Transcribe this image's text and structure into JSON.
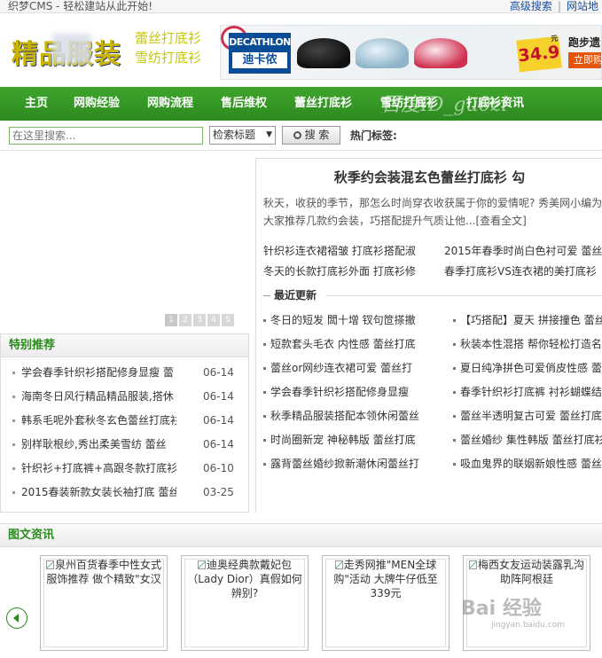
{
  "topbar": {
    "slogan": "织梦CMS - 轻松建站从此开始!",
    "links": [
      "高级搜索",
      "网站地"
    ]
  },
  "header": {
    "logo_text": "精品服装",
    "sub_lines": [
      "蕾丝打底衫",
      "雪纺打底衫"
    ],
    "banner": {
      "brand_en": "DECATHLON",
      "brand_cn": "迪卡侬",
      "price": "34.9",
      "price_unit": "元",
      "tag1": "跑步遗",
      "tag2": "立即购"
    }
  },
  "nav": {
    "items": [
      "主页",
      "网购经验",
      "网购流程",
      "售后维权",
      "蕾丝打底衫",
      "雪纺打底衫",
      "打底衫资讯"
    ],
    "watermark": "百度ID_gu0zi"
  },
  "search": {
    "placeholder": "在这里搜索...",
    "select_value": "检索标题",
    "button_label": "搜 索",
    "hot_label": "热门标签:"
  },
  "slideshow": {
    "pages": [
      "1",
      "2",
      "3",
      "4",
      "5"
    ]
  },
  "special": {
    "title": "特别推荐",
    "items": [
      {
        "title": "学会春季针织衫搭配修身显瘦 蕾",
        "date": "06-14"
      },
      {
        "title": "海南冬日风行精品精品服装,搭休",
        "date": "06-14"
      },
      {
        "title": "韩系毛呢外套秋冬玄色蕾丝打底衫",
        "date": "06-14"
      },
      {
        "title": "别样耿根纱,秀出柔美雪纺 蕾丝",
        "date": "06-14"
      },
      {
        "title": "针织衫+打底裤+高跟冬款打底衫搭",
        "date": "06-10"
      },
      {
        "title": "2015春装新款女装长袖打底 蕾丝",
        "date": "03-25"
      }
    ]
  },
  "headline": {
    "title": "秋季约会装混玄色蕾丝打底衫 勾",
    "summary": "秋天，收获的季节，那怎么时尚穿衣收获属于你的爱情呢? 秀美网小编为大家推荐几款约会装，巧搭配提升气质让他...",
    "more": "[查看全文]"
  },
  "related": [
    {
      "a": "针织衫连衣裙褶皱 打底衫搭配淑",
      "b": "2015年春季时尚白色衬可爱 蕾丝"
    },
    {
      "a": "冬天的长款打底衫外面 打底衫修",
      "b": "春季打底衫VS连衣裙的美打底衫"
    }
  ],
  "latest": {
    "title": "最近更新",
    "rows": [
      {
        "a": "冬日的短发 闆十增 钗句笸搽撤",
        "b": "【巧搭配】夏天 拼接撞色 蕾丝"
      },
      {
        "a": "短款套头毛衣 内性感 蕾丝打底",
        "b": "秋装本性混搭 帮你轻松打造名"
      },
      {
        "a": "蕾丝or网纱连衣裙可爱 蕾丝打",
        "b": "夏日纯净拼色可爱俏皮性感 蕾"
      },
      {
        "a": "学会春季针织衫搭配修身显瘦",
        "b": "春季针织衫打底裤 衬衫蝴蝶结"
      },
      {
        "a": "秋季精品服装搭配本领休闲蕾丝",
        "b": "蕾丝半透明复古可爱 蕾丝打底"
      },
      {
        "a": "时尚圈新宠 神秘韩版 蕾丝打底",
        "b": "蕾丝婚纱 集性韩版 蕾丝打底衫"
      },
      {
        "a": "露背蕾丝婚纱掀新潮休闲蕾丝打",
        "b": "吸血鬼界的联姻新娘性感 蕾丝"
      }
    ]
  },
  "picnews": {
    "title": "图文资讯",
    "items": [
      "泉州百货春季中性女式服饰推荐 做个精致\"女汉",
      "迪奥经典款戴妃包（Lady Dior）真假如何辨别?",
      "走秀网推\"MEN全球购\"活动 大牌牛仔低至339元",
      "梅西女友运动装露乳沟 助阵阿根廷"
    ]
  },
  "watermark2": {
    "main": "Bai 经验",
    "sub": "jingyan.baidu.com"
  }
}
